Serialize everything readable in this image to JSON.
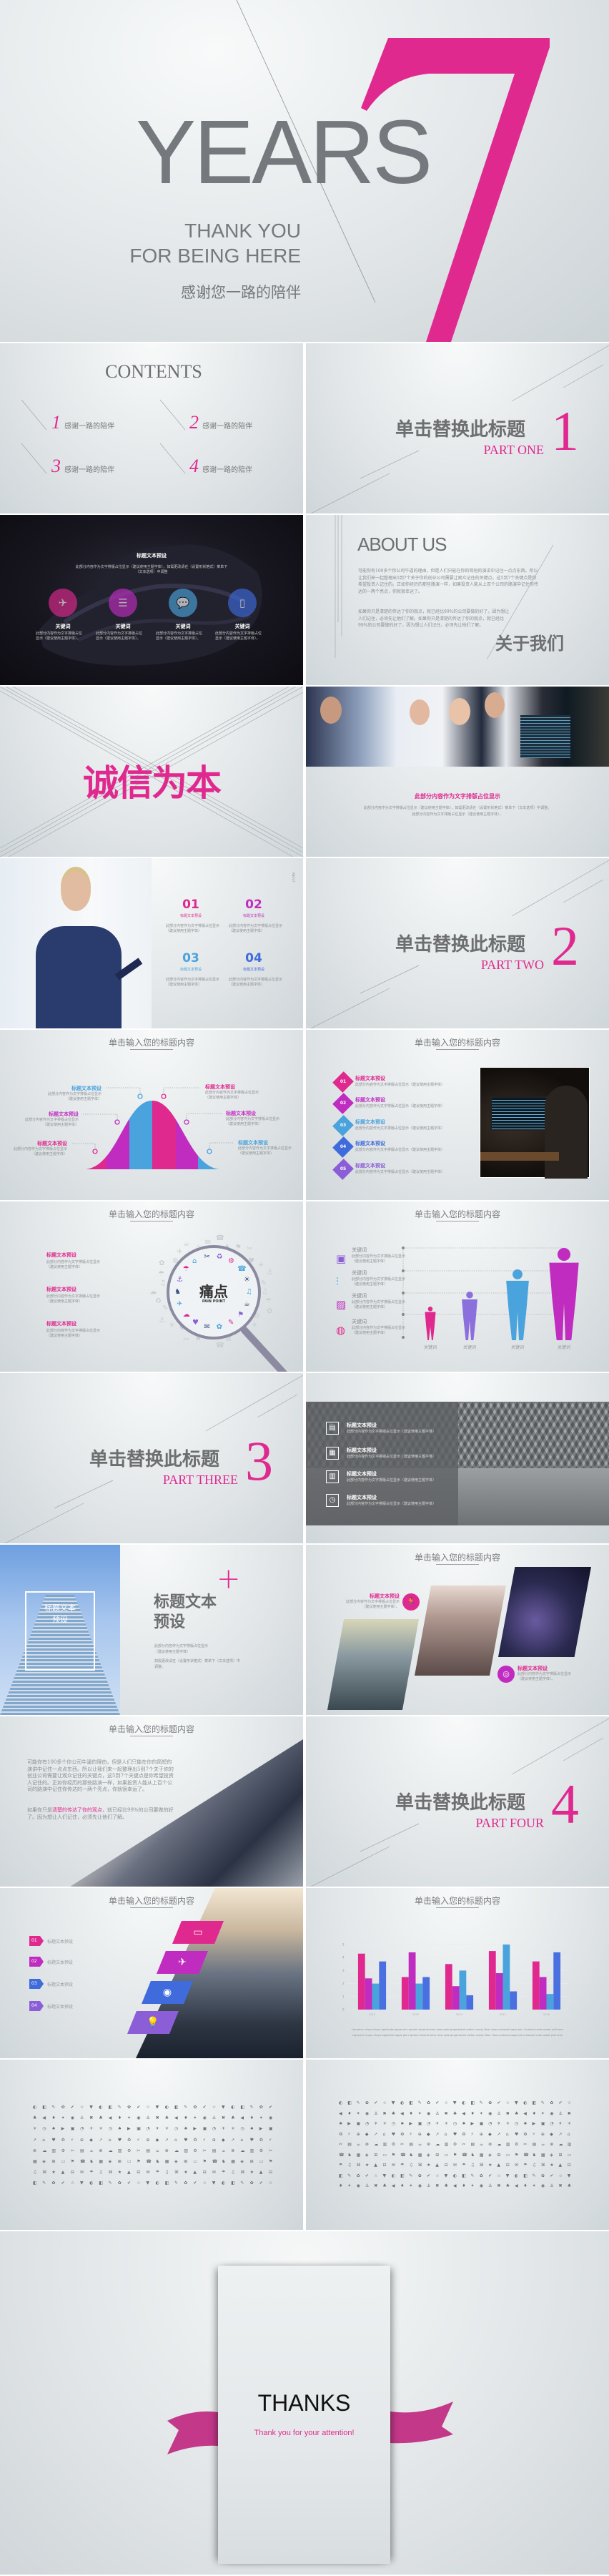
{
  "colors": {
    "pink": "#e0298f",
    "purple": "#c02cc0",
    "sky": "#4aa3dc",
    "blue": "#3f6bdc",
    "violet": "#8b5ed8",
    "grey": "#6d6e70"
  },
  "cover": {
    "big": "YEARS",
    "number": "7",
    "line1": "THANK YOU",
    "line2": "FOR BEING HERE",
    "subtitle": "感谢您一路的陪伴"
  },
  "contents": {
    "title": "CONTENTS",
    "items": [
      {
        "num": "1",
        "label": "感谢一路的陪伴"
      },
      {
        "num": "2",
        "label": "感谢一路的陪伴"
      },
      {
        "num": "3",
        "label": "感谢一路的陪伴"
      },
      {
        "num": "4",
        "label": "感谢一路的陪伴"
      }
    ]
  },
  "parts": [
    {
      "title": "单击替换此标题",
      "label": "PART ONE",
      "num": "1"
    },
    {
      "title": "单击替换此标题",
      "label": "PART TWO",
      "num": "2"
    },
    {
      "title": "单击替换此标题",
      "label": "PART THREE",
      "num": "3"
    },
    {
      "title": "单击替换此标题",
      "label": "PART FOUR",
      "num": "4"
    }
  ],
  "dark": {
    "title": "标题文本预设",
    "desc1": "此部分内容作为文字排版占位显示（建议使用主题字体），如需更改请在（设置形状格式）菜单下",
    "desc2": "（文本选项）中调整",
    "items": [
      {
        "label": "关键词",
        "desc1": "此部分内容作为文字排版占位",
        "desc2": "显示（建议使用主题字体）。",
        "icon": "paper-plane-icon"
      },
      {
        "label": "关键词",
        "desc1": "此部分内容作为文字排版占位",
        "desc2": "显示（建议使用主题字体）。",
        "icon": "database-icon"
      },
      {
        "label": "关键词",
        "desc1": "此部分内容作为文字排版占位",
        "desc2": "显示（建议使用主题字体）。",
        "icon": "chat-bubble-icon"
      },
      {
        "label": "关键词",
        "desc1": "此部分内容作为文字排版占位",
        "desc2": "显示（建议使用主题字体）。",
        "icon": "smartphone-icon"
      }
    ]
  },
  "about": {
    "title": "ABOUT US",
    "p1": "可能你有100多个你公司牛逼的理由，但是人们只能在你的简短的演讲中记住一点点东西。所以让我们来一起整理出5到7个关于你的创业公司需要让观众记住的关键点。这5到7个关键点是你希望投资人记住的。正如你经历的那些路演一样，如果投资人能从上百个公司的路演中记住你传达的一两个亮点，你就很幸运了。",
    "p2": "如果你只是清楚的传达了你的观点，就已经比99%的公司要做的好了，因为想让人们记住，必须先让他们了解。如果你只是清楚的传达了你的观点，就已经比99%的公司要做的好了，因为想让人们记住，必须先让他们了解。",
    "cn": "关于我们"
  },
  "integrity": {
    "text": "诚信为本"
  },
  "team": {
    "title": "此部分内容作为文字排版占位显示",
    "desc1": "此部分内容作为文字排版占位显示（建议使用主题字体），如需更改请在（设置形状格式）菜单下（文本选项）中调整。",
    "desc2": "此部分内容作为文字排版占位显示（建议使用主题字体）。"
  },
  "nurse": {
    "side": "ABOUT",
    "items": [
      {
        "num": "01",
        "title": "标题文本预设",
        "desc1": "此部分内容作为文字排版占位显示",
        "desc2": "（建议使用主题字体）"
      },
      {
        "num": "02",
        "title": "标题文本预设",
        "desc1": "此部分内容作为文字排版占位显示",
        "desc2": "（建议使用主题字体）"
      },
      {
        "num": "03",
        "title": "标题文本预设",
        "desc1": "此部分内容作为文字排版占位显示",
        "desc2": "（建议使用主题字体）"
      },
      {
        "num": "04",
        "title": "标题文本预设",
        "desc1": "此部分内容作为文字排版占位显示",
        "desc2": "（建议使用主题字体）"
      }
    ]
  },
  "slide_header": "单击输入您的标题内容",
  "bell": {
    "labels": [
      {
        "title": "标题文本预设",
        "desc1": "此部分内容作为文字排版占位显示",
        "desc2": "（建议使用主题字体）"
      },
      {
        "title": "标题文本预设",
        "desc1": "此部分内容作为文字排版占位显示",
        "desc2": "（建议使用主题字体）"
      },
      {
        "title": "标题文本预设",
        "desc1": "此部分内容作为文字排版占位显示",
        "desc2": "（建议使用主题字体）"
      },
      {
        "title": "标题文本预设",
        "desc1": "此部分内容作为文字排版占位显示",
        "desc2": "（建议使用主题字体）"
      },
      {
        "title": "标题文本预设",
        "desc1": "此部分内容作为文字排版占位显示",
        "desc2": "（建议使用主题字体）"
      },
      {
        "title": "标题文本预设",
        "desc1": "此部分内容作为文字排版占位显示",
        "desc2": "（建议使用主题字体）"
      }
    ]
  },
  "steps": {
    "items": [
      {
        "num": "01",
        "title": "标题文本预设",
        "desc": "此部分内容作为文字排版占位显示（建议使用主题字体）"
      },
      {
        "num": "02",
        "title": "标题文本预设",
        "desc": "此部分内容作为文字排版占位显示（建议使用主题字体）"
      },
      {
        "num": "03",
        "title": "标题文本预设",
        "desc": "此部分内容作为文字排版占位显示（建议使用主题字体）"
      },
      {
        "num": "04",
        "title": "标题文本预设",
        "desc": "此部分内容作为文字排版占位显示（建议使用主题字体）"
      },
      {
        "num": "05",
        "title": "标题文本预设",
        "desc": "此部分内容作为文字排版占位显示（建议使用主题字体）"
      }
    ]
  },
  "pain": {
    "title": "痛点",
    "sub": "PAIN POINT",
    "items": [
      {
        "title": "标题文本预设",
        "desc1": "此部分内容作为文字排版占位显示",
        "desc2": "（建议使用主题字体）"
      },
      {
        "title": "标题文本预设",
        "desc1": "此部分内容作为文字排版占位显示",
        "desc2": "（建议使用主题字体）"
      },
      {
        "title": "标题文本预设",
        "desc1": "此部分内容作为文字排版占位显示",
        "desc2": "（建议使用主题字体）"
      }
    ]
  },
  "people": {
    "items": [
      {
        "title": "关键词",
        "desc1": "此部分内容作为文字排版占位显示",
        "desc2": "（建议使用主题字体）",
        "icon": "wallet-icon"
      },
      {
        "title": "关键词",
        "desc1": "此部分内容作为文字排版占位显示",
        "desc2": "（建议使用主题字体）",
        "icon": "sliders-icon"
      },
      {
        "title": "关键词",
        "desc1": "此部分内容作为文字排版占位显示",
        "desc2": "（建议使用主题字体）",
        "icon": "image-icon"
      },
      {
        "title": "关键词",
        "desc1": "此部分内容作为文字排版占位显示",
        "desc2": "（建议使用主题字体）",
        "icon": "globe-icon"
      }
    ],
    "labels": [
      "关键词",
      "关键词",
      "关键词",
      "关键词"
    ]
  },
  "arch": {
    "items": [
      {
        "title": "标题文本预设",
        "desc": "此部分内容作为文字排版占位显示（建议使用主题字体）",
        "icon": "monitor-chart-icon"
      },
      {
        "title": "标题文本预设",
        "desc": "此部分内容作为文字排版占位显示（建议使用主题字体）",
        "icon": "id-card-icon"
      },
      {
        "title": "标题文本预设",
        "desc": "此部分内容作为文字排版占位显示（建议使用主题字体）",
        "icon": "monitor-bars-icon"
      },
      {
        "title": "标题文本预设",
        "desc": "此部分内容作为文字排版占位显示（建议使用主题字体）",
        "icon": "browser-clock-icon"
      }
    ]
  },
  "building": {
    "frame1": "标题文本",
    "frame2": "预设",
    "title1": "标题文本",
    "title2": "预设",
    "plus": "+",
    "p1": "此部分内容作为文字排版占位显示",
    "p2": "（建议使用主题字体）",
    "p3": "如需更改请在（设置形状格式）菜单下（文本选项）中",
    "p4": "调整。"
  },
  "cities": {
    "items": [
      {
        "title": "标题文本预设",
        "desc1": "此部分内容作为文字排版占位显示",
        "desc2": "（建议使用主题字体）。",
        "icon": "runner-icon"
      },
      {
        "title": "标题文本预设",
        "desc1": "此部分内容作为文字排版占位显示",
        "desc2": "（建议使用主题字体）。",
        "icon": "vr-headset-icon"
      }
    ]
  },
  "story": {
    "p1": "可能你有100多个你公司牛逼的理由，但是人们只能在你的简短的演讲中记住一点点东西。所以让我们来一起整理出5到7个关于你的创业公司需要让观众记住的关键点，这5到7个关键点是你希望投资人记住的。正如你经历的那些路演一样，如果投资人能从上百个公司的路演中记住你传达的一两个亮点，你就很幸运了。",
    "p2_pre": "如果你只是",
    "p2_hl": "清楚的传达了你的观点",
    "p2_post": "，就已经比99%的公司要做的好了。因为想让人们记住，必须先让他们了解。"
  },
  "list4": {
    "items": [
      {
        "num": "01",
        "label": "标题文本预设",
        "icon": "monitor-icon"
      },
      {
        "num": "02",
        "label": "标题文本预设",
        "icon": "paper-plane-icon"
      },
      {
        "num": "03",
        "label": "标题文本预设",
        "icon": "camera-icon"
      },
      {
        "num": "04",
        "label": "标题文本预设",
        "icon": "lightbulb-icon"
      }
    ]
  },
  "chart_data": {
    "type": "bar",
    "categories": [
      "2012",
      "2013",
      "2014",
      "2015",
      "2016"
    ],
    "series": [
      {
        "values": [
          4.3,
          2.5,
          3.5,
          4.5,
          3.7
        ],
        "color": "#e0298f"
      },
      {
        "values": [
          2.4,
          4.4,
          1.8,
          2.8,
          2.5
        ],
        "color": "#c02cc0"
      },
      {
        "values": [
          2.0,
          2.0,
          3.0,
          5.0,
          1.2
        ],
        "color": "#4aa3dc"
      },
      {
        "values": [
          3.7,
          2.5,
          1.1,
          1.4,
          4.4
        ],
        "color": "#4a6fe0"
      }
    ],
    "ylim": [
      0,
      5
    ],
    "yticks": [
      "0",
      "1",
      "2",
      "3",
      "4",
      "5"
    ],
    "grid": true,
    "legend": "none",
    "caption": [
      "Liquorice chupa chups applicake apple pie cupcake brownie bear claw cake gingerbread cotton candy. Bear claw croissant apple pie. Croissant cake sweet puff oreo",
      "Liquorice chupa chups applicake apple pie cupcake brownie bear claw cake gingerbread cotton candy. Bear claw croissant apple pie croissant cake sweet puff oreo"
    ]
  },
  "thanks": {
    "title": "THANKS",
    "sub": "Thank you for your attention!"
  }
}
